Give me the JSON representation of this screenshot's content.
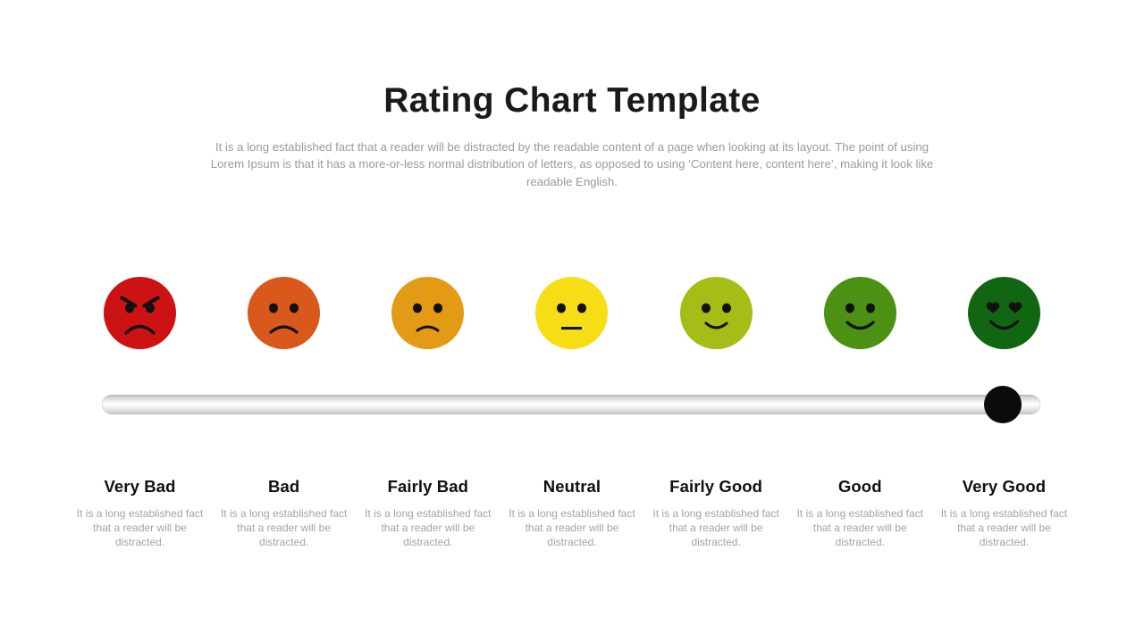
{
  "header": {
    "title": "Rating Chart Template",
    "subtitle": "It is a long established fact that a reader will be distracted by the readable content of a page when looking at its layout. The point of using Lorem Ipsum is that it has a more-or-less normal distribution of letters, as opposed to using ‘Content here, content here’, making it look like readable English."
  },
  "slider": {
    "knob_label": "slider-knob",
    "track_label": "slider-track",
    "selected_index": 6,
    "selected_value": "Very Good"
  },
  "ratings": [
    {
      "label": "Very Bad",
      "description": "It is a long established fact that a reader will be distracted.",
      "color": "#CC1212",
      "face": "angry-face-icon"
    },
    {
      "label": "Bad",
      "description": "It is a long established fact that a reader will be distracted.",
      "color": "#D9581B",
      "face": "frowning-face-icon"
    },
    {
      "label": "Fairly Bad",
      "description": "It is a long established fact that a reader will be distracted.",
      "color": "#E39B16",
      "face": "slightly-frowning-face-icon"
    },
    {
      "label": "Neutral",
      "description": "It is a long established fact that a reader will be distracted.",
      "color": "#F7DD16",
      "face": "neutral-face-icon"
    },
    {
      "label": "Fairly Good",
      "description": "It is a long established fact that a reader will be distracted.",
      "color": "#A5BD16",
      "face": "slightly-smiling-face-icon"
    },
    {
      "label": "Good",
      "description": "It is a long established fact that a reader will be distracted.",
      "color": "#4C9113",
      "face": "smiling-face-icon"
    },
    {
      "label": "Very Good",
      "description": "It is a long established fact that a reader will be distracted.",
      "color": "#116611",
      "face": "heart-eyes-face-icon"
    }
  ]
}
